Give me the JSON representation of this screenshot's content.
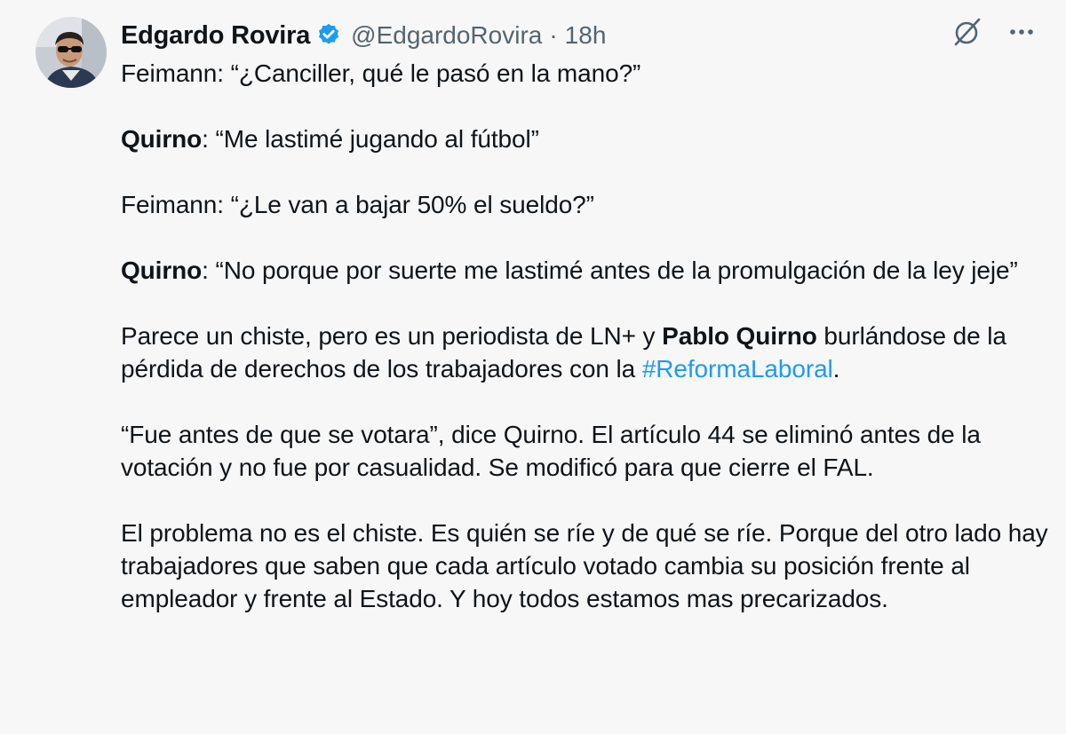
{
  "author": {
    "name": "Edgardo Rovira",
    "handle": "@EdgardoRovira",
    "separator": "·",
    "time": "18h",
    "verified_color": "#1d9bf0"
  },
  "icons": {
    "grok": "grok-icon",
    "more": "more-icon",
    "verified": "verified-badge-icon"
  },
  "tweet": {
    "p1": "Feimann: “¿Canciller, qué le pasó en la mano?”",
    "p2_bold": "Quirno",
    "p2_text": ": “Me lastimé jugando al fútbol”",
    "p3": "Feimann: “¿Le van a bajar 50% el sueldo?”",
    "p4_bold": "Quirno",
    "p4_text": ": “No porque por suerte me lastimé antes de la promulgación de la ley jeje”",
    "p5_a": "Parece un chiste, pero es un periodista de LN+ y ",
    "p5_bold": "Pablo Quirno",
    "p5_b": " burlándose de la pérdida de derechos de los trabajadores con la ",
    "p5_hashtag": "#ReformaLaboral",
    "p5_c": ".",
    "p6": "“Fue antes de que se votara”, dice Quirno. El artículo 44 se eliminó antes de la votación y no fue por casualidad. Se modificó para que cierre el FAL.",
    "p7": "El problema no es el chiste. Es quién se ríe y de qué se ríe. Porque del otro lado hay trabajadores que saben que cada artículo votado cambia su posición frente al empleador y frente al Estado. Y hoy todos estamos mas precarizados."
  },
  "colors": {
    "text": "#0f1419",
    "secondary": "#536471",
    "link": "#1d9bf0",
    "background": "#f7f7f7"
  }
}
